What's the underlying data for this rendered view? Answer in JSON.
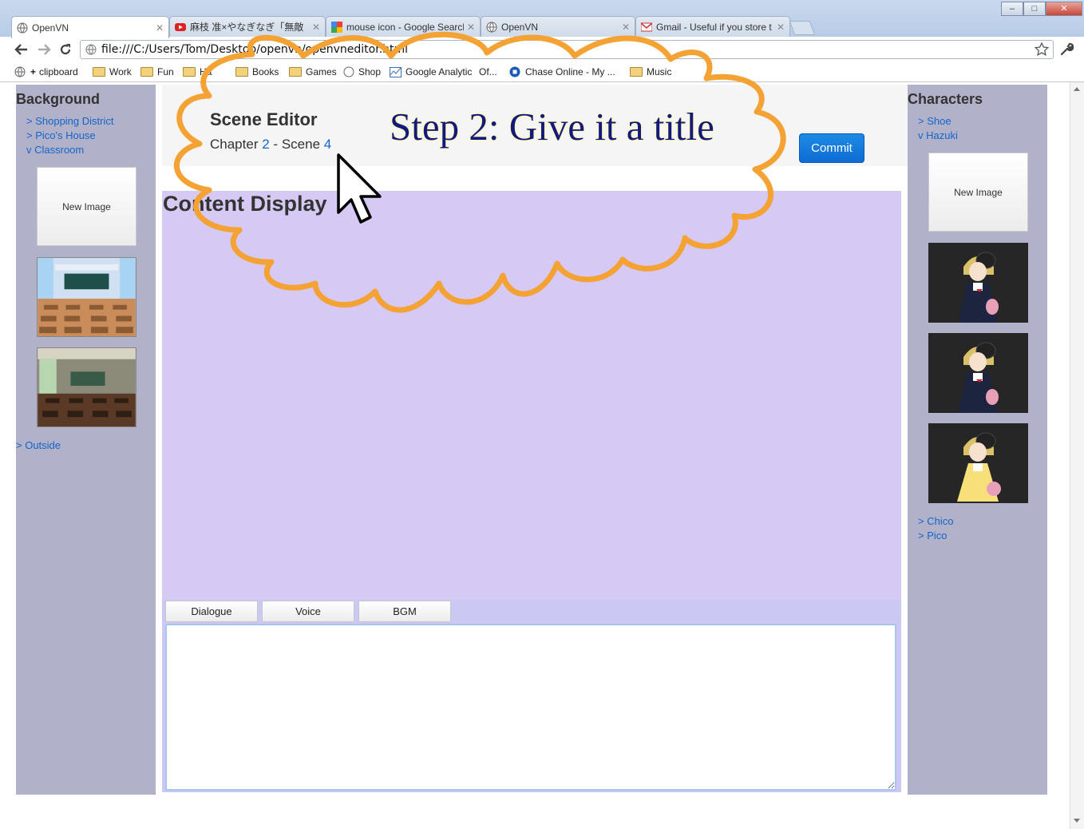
{
  "browser": {
    "tabs": [
      {
        "label": "OpenVN",
        "icon": "globe-icon",
        "active": true
      },
      {
        "label": "麻枝 准×やなぎなぎ「無敵",
        "icon": "youtube-icon"
      },
      {
        "label": "mouse icon - Google Searcl",
        "icon": "google-icon"
      },
      {
        "label": "OpenVN",
        "icon": "globe-icon"
      },
      {
        "label": "Gmail - Useful if you store t",
        "icon": "gmail-icon"
      }
    ],
    "url": "file:///C:/Users/Tom/Desktop/openvn/openvneditor.html",
    "bookmarks": [
      "clipboard",
      "Work",
      "Fun",
      "Ha",
      "Books",
      "Games",
      "Shop",
      "Google Analytic",
      "Of...",
      "Chase Online - My ...",
      "Music"
    ]
  },
  "background_panel": {
    "title": "Background",
    "groups": [
      "> Shopping District",
      "> Pico's House",
      "v Classroom"
    ],
    "new_image_label": "New Image",
    "outside_label": "> Outside"
  },
  "header": {
    "title": "Scene Editor",
    "chapter_label": "Chapter",
    "chapter_number": "2",
    "separator": "-",
    "scene_label": "Scene",
    "scene_number": "4",
    "commit_label": "Commit"
  },
  "annotation": {
    "text": "Step 2: Give it a title",
    "color": "#f4a233"
  },
  "content": {
    "title": "Content Display",
    "tabs": [
      "Dialogue",
      "Voice",
      "BGM"
    ],
    "editor_value": ""
  },
  "characters_panel": {
    "title": "Characters",
    "groups": [
      "> Shoe",
      "v Hazuki"
    ],
    "new_image_label": "New Image",
    "more": [
      "> Chico",
      "> Pico"
    ]
  },
  "colors": {
    "sidebar": "#b1b1c9",
    "content_bg": "#d6c9f3",
    "link": "#1565c9",
    "commit": "#0d6cd2"
  }
}
